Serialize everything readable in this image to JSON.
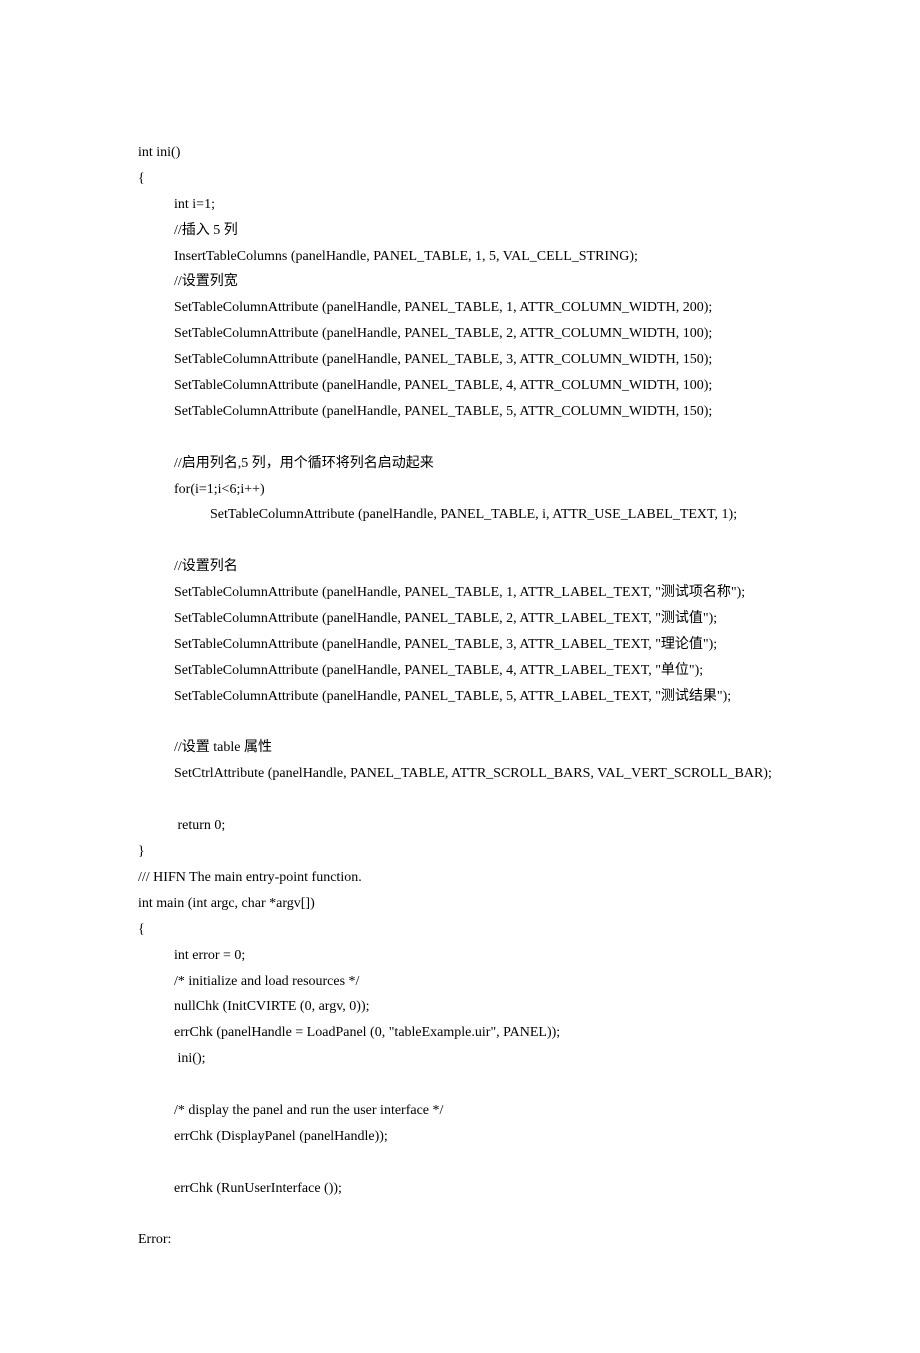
{
  "code": {
    "l1": "int ini()",
    "l2": "{",
    "l3": "int i=1;",
    "l4": "//插入 5 列",
    "l5": "InsertTableColumns (panelHandle, PANEL_TABLE, 1, 5, VAL_CELL_STRING);",
    "l6": "//设置列宽",
    "l7": "SetTableColumnAttribute (panelHandle, PANEL_TABLE, 1, ATTR_COLUMN_WIDTH, 200);",
    "l8": "SetTableColumnAttribute (panelHandle, PANEL_TABLE, 2, ATTR_COLUMN_WIDTH, 100);",
    "l9": "SetTableColumnAttribute (panelHandle, PANEL_TABLE, 3, ATTR_COLUMN_WIDTH, 150);",
    "l10": "SetTableColumnAttribute (panelHandle, PANEL_TABLE, 4, ATTR_COLUMN_WIDTH, 100);",
    "l11": "SetTableColumnAttribute (panelHandle, PANEL_TABLE, 5, ATTR_COLUMN_WIDTH, 150);",
    "l12": "//启用列名,5 列，用个循环将列名启动起来",
    "l13": "for(i=1;i<6;i++)",
    "l14": "SetTableColumnAttribute (panelHandle, PANEL_TABLE, i, ATTR_USE_LABEL_TEXT, 1);",
    "l15": "//设置列名",
    "l16": "SetTableColumnAttribute (panelHandle, PANEL_TABLE, 1, ATTR_LABEL_TEXT, \"测试项名称\");",
    "l17": "SetTableColumnAttribute (panelHandle, PANEL_TABLE, 2, ATTR_LABEL_TEXT, \"测试值\");",
    "l18": "SetTableColumnAttribute (panelHandle, PANEL_TABLE, 3, ATTR_LABEL_TEXT, \"理论值\");",
    "l19": "SetTableColumnAttribute (panelHandle, PANEL_TABLE, 4, ATTR_LABEL_TEXT, \"单位\");",
    "l20": "SetTableColumnAttribute (panelHandle, PANEL_TABLE, 5, ATTR_LABEL_TEXT, \"测试结果\");",
    "l21": "//设置 table 属性",
    "l22": "SetCtrlAttribute (panelHandle, PANEL_TABLE, ATTR_SCROLL_BARS, VAL_VERT_SCROLL_BAR);",
    "l23": " return 0;",
    "l24": "}",
    "l25": "/// HIFN The main entry-point function.",
    "l26": "int main (int argc, char *argv[])",
    "l27": "{",
    "l28": "int error = 0;",
    "l29": "/* initialize and load resources */",
    "l30": "nullChk (InitCVIRTE (0, argv, 0));",
    "l31": "errChk (panelHandle = LoadPanel (0, \"tableExample.uir\", PANEL));",
    "l32": " ini();",
    "l33": "/* display the panel and run the user interface */",
    "l34": "errChk (DisplayPanel (panelHandle));",
    "l35": "errChk (RunUserInterface ());",
    "l36": "Error:"
  }
}
